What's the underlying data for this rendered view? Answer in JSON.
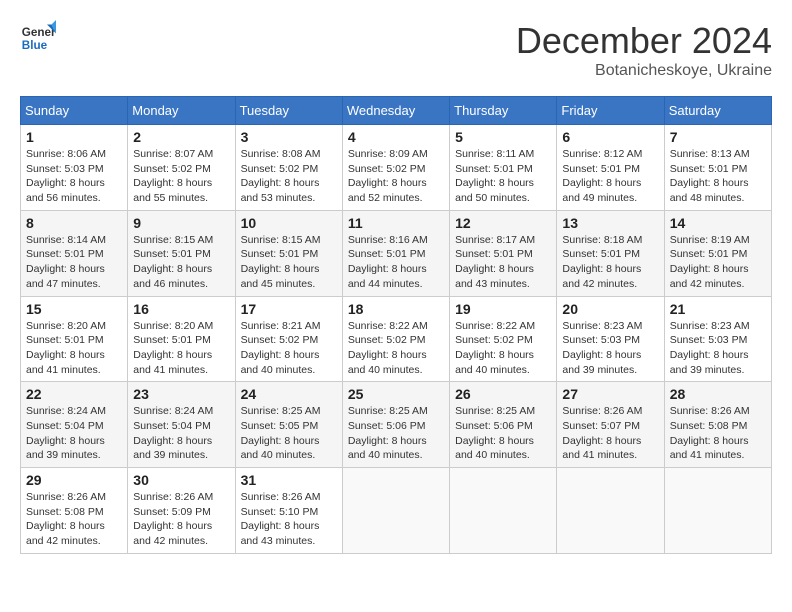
{
  "header": {
    "logo_line1": "General",
    "logo_line2": "Blue",
    "month": "December 2024",
    "location": "Botanicheskoye, Ukraine"
  },
  "weekdays": [
    "Sunday",
    "Monday",
    "Tuesday",
    "Wednesday",
    "Thursday",
    "Friday",
    "Saturday"
  ],
  "weeks": [
    [
      {
        "day": "1",
        "sunrise": "Sunrise: 8:06 AM",
        "sunset": "Sunset: 5:03 PM",
        "daylight": "Daylight: 8 hours and 56 minutes."
      },
      {
        "day": "2",
        "sunrise": "Sunrise: 8:07 AM",
        "sunset": "Sunset: 5:02 PM",
        "daylight": "Daylight: 8 hours and 55 minutes."
      },
      {
        "day": "3",
        "sunrise": "Sunrise: 8:08 AM",
        "sunset": "Sunset: 5:02 PM",
        "daylight": "Daylight: 8 hours and 53 minutes."
      },
      {
        "day": "4",
        "sunrise": "Sunrise: 8:09 AM",
        "sunset": "Sunset: 5:02 PM",
        "daylight": "Daylight: 8 hours and 52 minutes."
      },
      {
        "day": "5",
        "sunrise": "Sunrise: 8:11 AM",
        "sunset": "Sunset: 5:01 PM",
        "daylight": "Daylight: 8 hours and 50 minutes."
      },
      {
        "day": "6",
        "sunrise": "Sunrise: 8:12 AM",
        "sunset": "Sunset: 5:01 PM",
        "daylight": "Daylight: 8 hours and 49 minutes."
      },
      {
        "day": "7",
        "sunrise": "Sunrise: 8:13 AM",
        "sunset": "Sunset: 5:01 PM",
        "daylight": "Daylight: 8 hours and 48 minutes."
      }
    ],
    [
      {
        "day": "8",
        "sunrise": "Sunrise: 8:14 AM",
        "sunset": "Sunset: 5:01 PM",
        "daylight": "Daylight: 8 hours and 47 minutes."
      },
      {
        "day": "9",
        "sunrise": "Sunrise: 8:15 AM",
        "sunset": "Sunset: 5:01 PM",
        "daylight": "Daylight: 8 hours and 46 minutes."
      },
      {
        "day": "10",
        "sunrise": "Sunrise: 8:15 AM",
        "sunset": "Sunset: 5:01 PM",
        "daylight": "Daylight: 8 hours and 45 minutes."
      },
      {
        "day": "11",
        "sunrise": "Sunrise: 8:16 AM",
        "sunset": "Sunset: 5:01 PM",
        "daylight": "Daylight: 8 hours and 44 minutes."
      },
      {
        "day": "12",
        "sunrise": "Sunrise: 8:17 AM",
        "sunset": "Sunset: 5:01 PM",
        "daylight": "Daylight: 8 hours and 43 minutes."
      },
      {
        "day": "13",
        "sunrise": "Sunrise: 8:18 AM",
        "sunset": "Sunset: 5:01 PM",
        "daylight": "Daylight: 8 hours and 42 minutes."
      },
      {
        "day": "14",
        "sunrise": "Sunrise: 8:19 AM",
        "sunset": "Sunset: 5:01 PM",
        "daylight": "Daylight: 8 hours and 42 minutes."
      }
    ],
    [
      {
        "day": "15",
        "sunrise": "Sunrise: 8:20 AM",
        "sunset": "Sunset: 5:01 PM",
        "daylight": "Daylight: 8 hours and 41 minutes."
      },
      {
        "day": "16",
        "sunrise": "Sunrise: 8:20 AM",
        "sunset": "Sunset: 5:01 PM",
        "daylight": "Daylight: 8 hours and 41 minutes."
      },
      {
        "day": "17",
        "sunrise": "Sunrise: 8:21 AM",
        "sunset": "Sunset: 5:02 PM",
        "daylight": "Daylight: 8 hours and 40 minutes."
      },
      {
        "day": "18",
        "sunrise": "Sunrise: 8:22 AM",
        "sunset": "Sunset: 5:02 PM",
        "daylight": "Daylight: 8 hours and 40 minutes."
      },
      {
        "day": "19",
        "sunrise": "Sunrise: 8:22 AM",
        "sunset": "Sunset: 5:02 PM",
        "daylight": "Daylight: 8 hours and 40 minutes."
      },
      {
        "day": "20",
        "sunrise": "Sunrise: 8:23 AM",
        "sunset": "Sunset: 5:03 PM",
        "daylight": "Daylight: 8 hours and 39 minutes."
      },
      {
        "day": "21",
        "sunrise": "Sunrise: 8:23 AM",
        "sunset": "Sunset: 5:03 PM",
        "daylight": "Daylight: 8 hours and 39 minutes."
      }
    ],
    [
      {
        "day": "22",
        "sunrise": "Sunrise: 8:24 AM",
        "sunset": "Sunset: 5:04 PM",
        "daylight": "Daylight: 8 hours and 39 minutes."
      },
      {
        "day": "23",
        "sunrise": "Sunrise: 8:24 AM",
        "sunset": "Sunset: 5:04 PM",
        "daylight": "Daylight: 8 hours and 39 minutes."
      },
      {
        "day": "24",
        "sunrise": "Sunrise: 8:25 AM",
        "sunset": "Sunset: 5:05 PM",
        "daylight": "Daylight: 8 hours and 40 minutes."
      },
      {
        "day": "25",
        "sunrise": "Sunrise: 8:25 AM",
        "sunset": "Sunset: 5:06 PM",
        "daylight": "Daylight: 8 hours and 40 minutes."
      },
      {
        "day": "26",
        "sunrise": "Sunrise: 8:25 AM",
        "sunset": "Sunset: 5:06 PM",
        "daylight": "Daylight: 8 hours and 40 minutes."
      },
      {
        "day": "27",
        "sunrise": "Sunrise: 8:26 AM",
        "sunset": "Sunset: 5:07 PM",
        "daylight": "Daylight: 8 hours and 41 minutes."
      },
      {
        "day": "28",
        "sunrise": "Sunrise: 8:26 AM",
        "sunset": "Sunset: 5:08 PM",
        "daylight": "Daylight: 8 hours and 41 minutes."
      }
    ],
    [
      {
        "day": "29",
        "sunrise": "Sunrise: 8:26 AM",
        "sunset": "Sunset: 5:08 PM",
        "daylight": "Daylight: 8 hours and 42 minutes."
      },
      {
        "day": "30",
        "sunrise": "Sunrise: 8:26 AM",
        "sunset": "Sunset: 5:09 PM",
        "daylight": "Daylight: 8 hours and 42 minutes."
      },
      {
        "day": "31",
        "sunrise": "Sunrise: 8:26 AM",
        "sunset": "Sunset: 5:10 PM",
        "daylight": "Daylight: 8 hours and 43 minutes."
      },
      null,
      null,
      null,
      null
    ]
  ]
}
